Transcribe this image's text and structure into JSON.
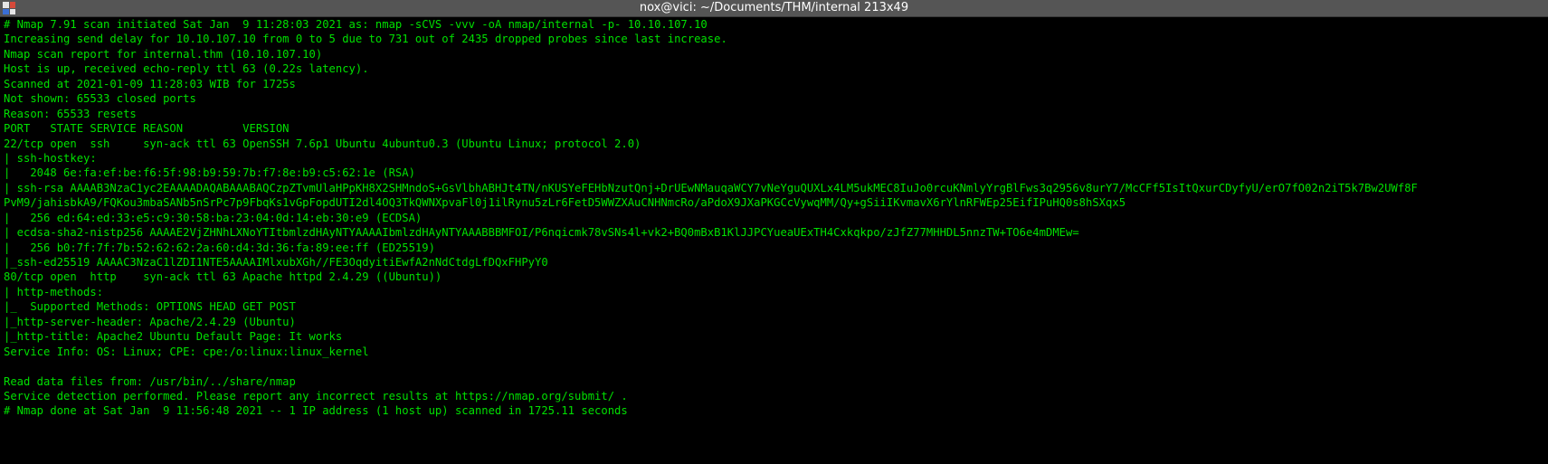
{
  "window": {
    "title": "nox@vici: ~/Documents/THM/internal 213x49",
    "icon": "terminal-app-icon"
  },
  "colors": {
    "background": "#000000",
    "text": "#00e000",
    "titlebar": "#555555"
  },
  "terminal": {
    "lines": [
      "# Nmap 7.91 scan initiated Sat Jan  9 11:28:03 2021 as: nmap -sCVS -vvv -oA nmap/internal -p- 10.10.107.10",
      "Increasing send delay for 10.10.107.10 from 0 to 5 due to 731 out of 2435 dropped probes since last increase.",
      "Nmap scan report for internal.thm (10.10.107.10)",
      "Host is up, received echo-reply ttl 63 (0.22s latency).",
      "Scanned at 2021-01-09 11:28:03 WIB for 1725s",
      "Not shown: 65533 closed ports",
      "Reason: 65533 resets",
      "PORT   STATE SERVICE REASON         VERSION",
      "22/tcp open  ssh     syn-ack ttl 63 OpenSSH 7.6p1 Ubuntu 4ubuntu0.3 (Ubuntu Linux; protocol 2.0)",
      "| ssh-hostkey: ",
      "|   2048 6e:fa:ef:be:f6:5f:98:b9:59:7b:f7:8e:b9:c5:62:1e (RSA)",
      "| ssh-rsa AAAAB3NzaC1yc2EAAAADAQABAAABAQCzpZTvmUlaHPpKH8X2SHMndoS+GsVlbhABHJt4TN/nKUSYeFEHbNzutQnj+DrUEwNMauqaWCY7vNeYguQUXLx4LM5ukMEC8IuJo0rcuKNmlyYrgBlFws3q2956v8urY7/McCFf5IsItQxurCDyfyU/erO7fO02n2iT5k7Bw2UWf8F",
      "PvM9/jahisbkA9/FQKou3mbaSANb5nSrPc7p9FbqKs1vGpFopdUTI2dl4OQ3TkQWNXpvaFl0j1ilRynu5zLr6FetD5WWZXAuCNHNmcRo/aPdoX9JXaPKGCcVywqMM/Qy+gSiiIKvmavX6rYlnRFWEp25EifIPuHQ0s8hSXqx5",
      "|   256 ed:64:ed:33:e5:c9:30:58:ba:23:04:0d:14:eb:30:e9 (ECDSA)",
      "| ecdsa-sha2-nistp256 AAAAE2VjZHNhLXNoYTItbmlzdHAyNTYAAAAIbmlzdHAyNTYAAABBBMFOI/P6nqicmk78vSNs4l+vk2+BQ0mBxB1KlJJPCYueaUExTH4Cxkqkpo/zJfZ77MHHDL5nnzTW+TO6e4mDMEw=",
      "|   256 b0:7f:7f:7b:52:62:62:2a:60:d4:3d:36:fa:89:ee:ff (ED25519)",
      "|_ssh-ed25519 AAAAC3NzaC1lZDI1NTE5AAAAIMlxubXGh//FE3OqdyitiEwfA2nNdCtdgLfDQxFHPyY0",
      "80/tcp open  http    syn-ack ttl 63 Apache httpd 2.4.29 ((Ubuntu))",
      "| http-methods: ",
      "|_  Supported Methods: OPTIONS HEAD GET POST",
      "|_http-server-header: Apache/2.4.29 (Ubuntu)",
      "|_http-title: Apache2 Ubuntu Default Page: It works",
      "Service Info: OS: Linux; CPE: cpe:/o:linux:linux_kernel",
      "",
      "Read data files from: /usr/bin/../share/nmap",
      "Service detection performed. Please report any incorrect results at https://nmap.org/submit/ .",
      "# Nmap done at Sat Jan  9 11:56:48 2021 -- 1 IP address (1 host up) scanned in 1725.11 seconds"
    ]
  }
}
